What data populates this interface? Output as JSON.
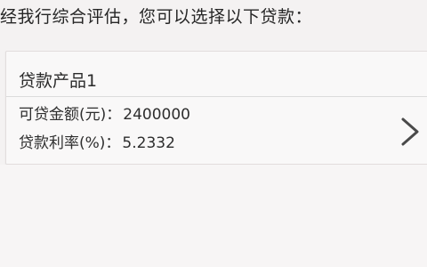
{
  "intro_text": "经我行综合评估，您可以选择以下贷款：",
  "loan_card": {
    "product_name": "贷款产品1",
    "amount_label": "可贷金额(元)：",
    "amount_value": "2400000",
    "rate_label": "贷款利率(%)：",
    "rate_value": "5.2332",
    "action_icon": "chevron-right-icon"
  }
}
